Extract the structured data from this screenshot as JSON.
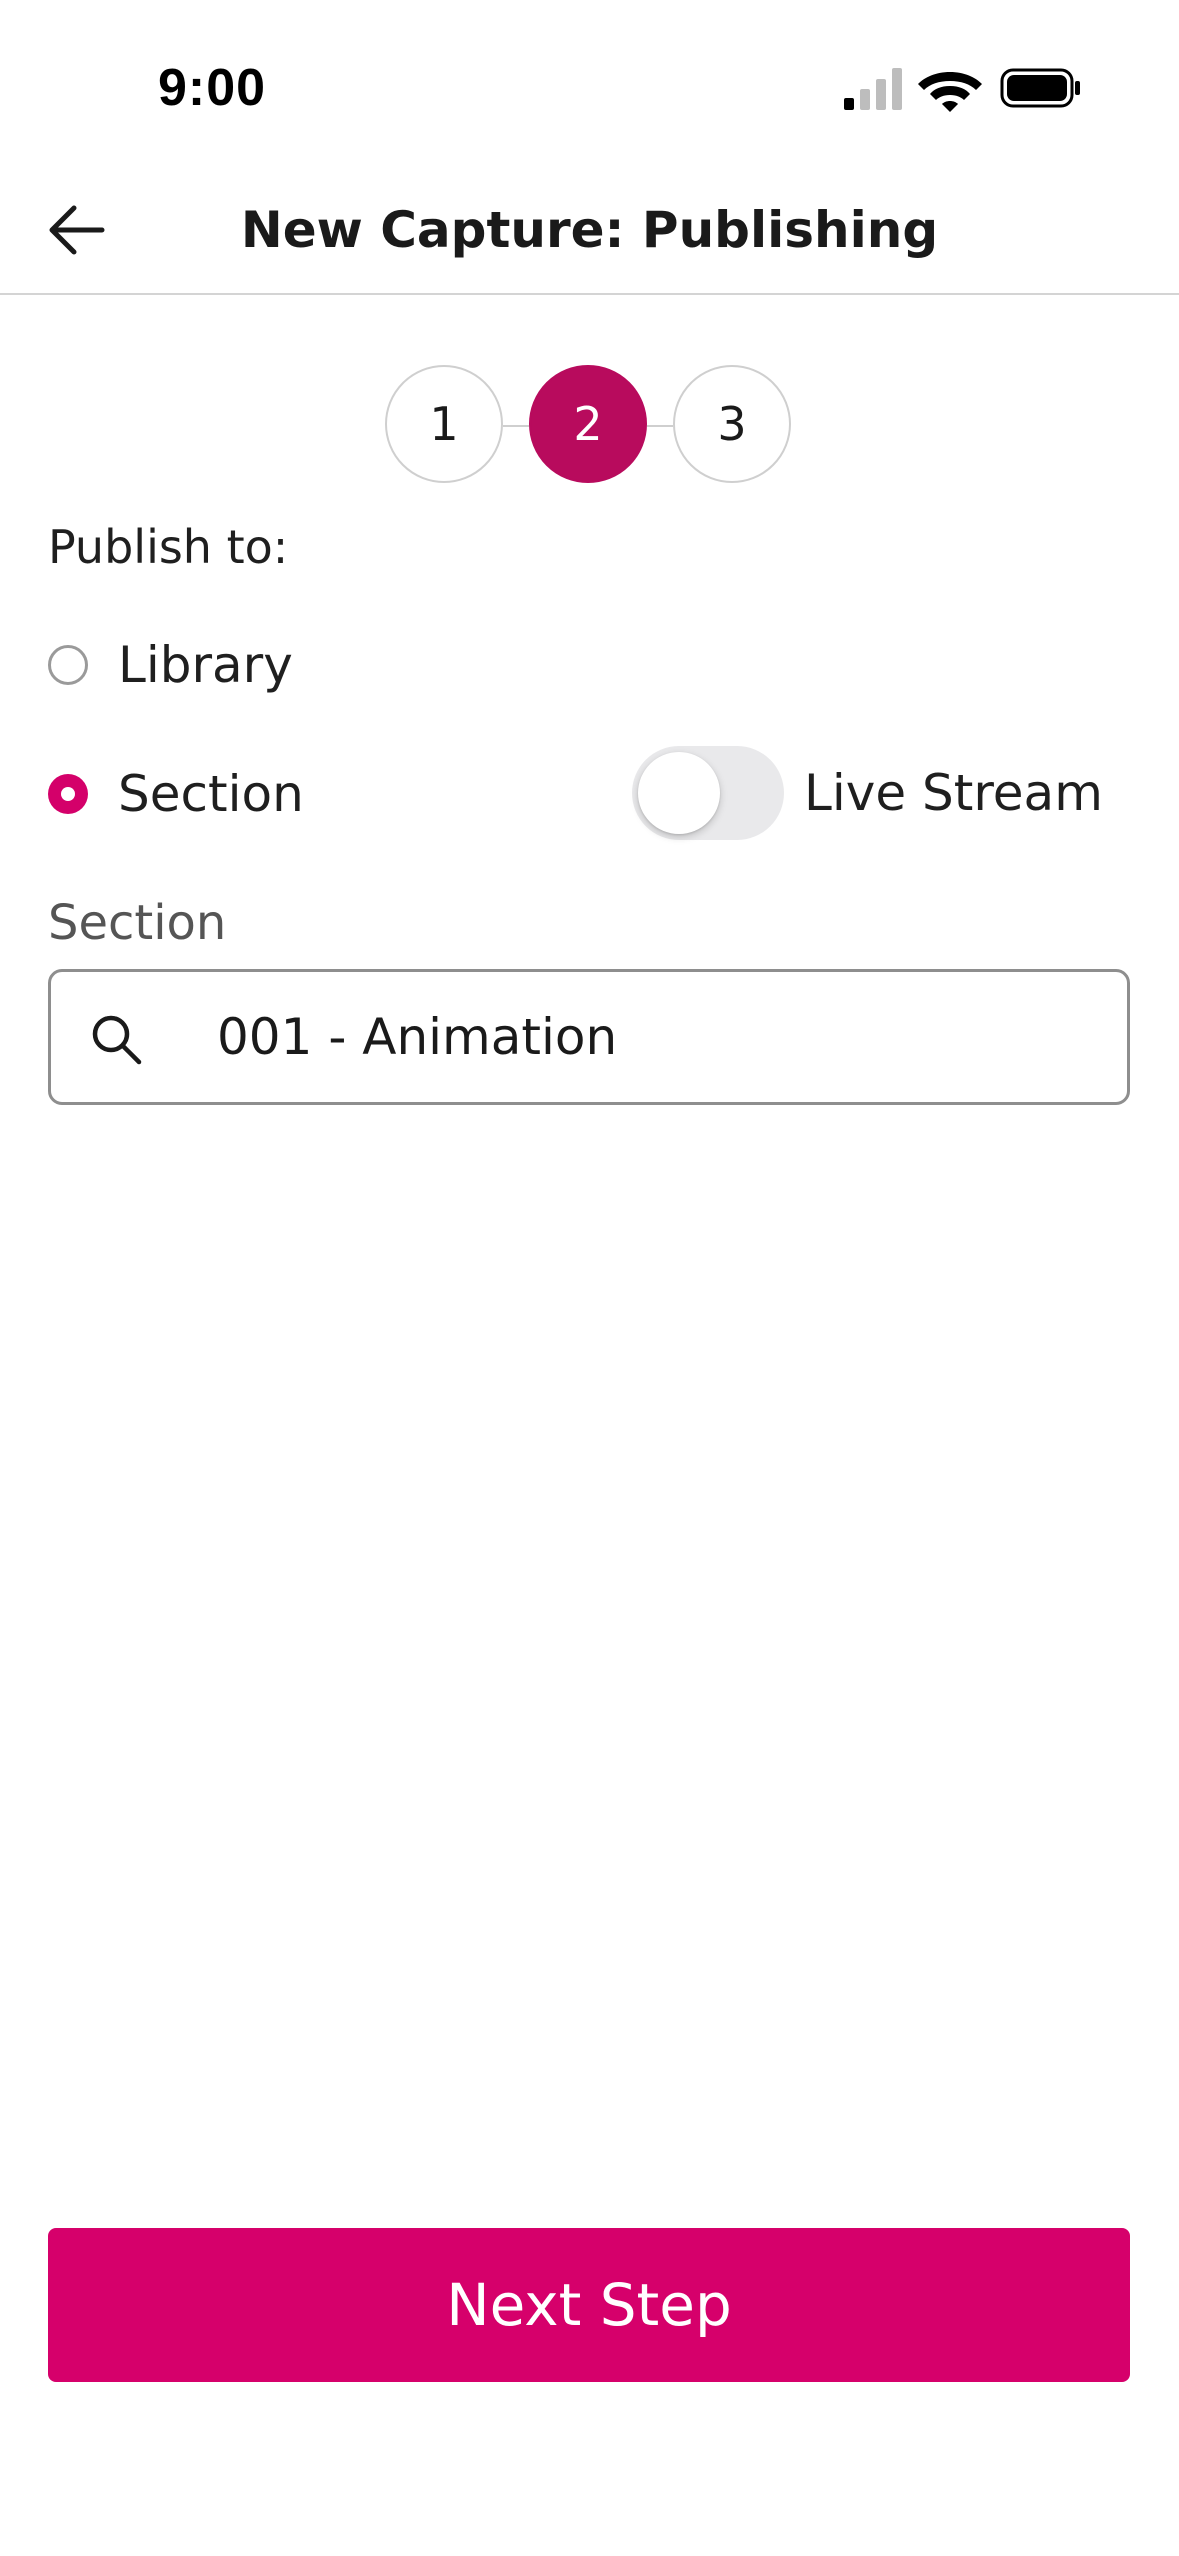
{
  "status_bar": {
    "time": "9:00",
    "icons": [
      "cellular-signal-icon",
      "wifi-icon",
      "battery-icon"
    ]
  },
  "header": {
    "back_icon": "arrow-left-icon",
    "title": "New Capture: Publishing"
  },
  "stepper": {
    "steps": [
      "1",
      "2",
      "3"
    ],
    "active_step": "2"
  },
  "form": {
    "publish_to_label": "Publish to:",
    "options": [
      {
        "label": "Library",
        "selected": false
      },
      {
        "label": "Section",
        "selected": true
      }
    ],
    "live_stream": {
      "label": "Live Stream",
      "enabled": false
    },
    "section_field": {
      "label": "Section",
      "icon": "search-icon",
      "value": "001 - Animation"
    }
  },
  "actions": {
    "next_label": "Next Step"
  },
  "colors": {
    "accent": "#d6006b",
    "active_step": "#b80b5d",
    "divider": "#d4d4d4",
    "toggle_off": "#e9e9eb"
  }
}
